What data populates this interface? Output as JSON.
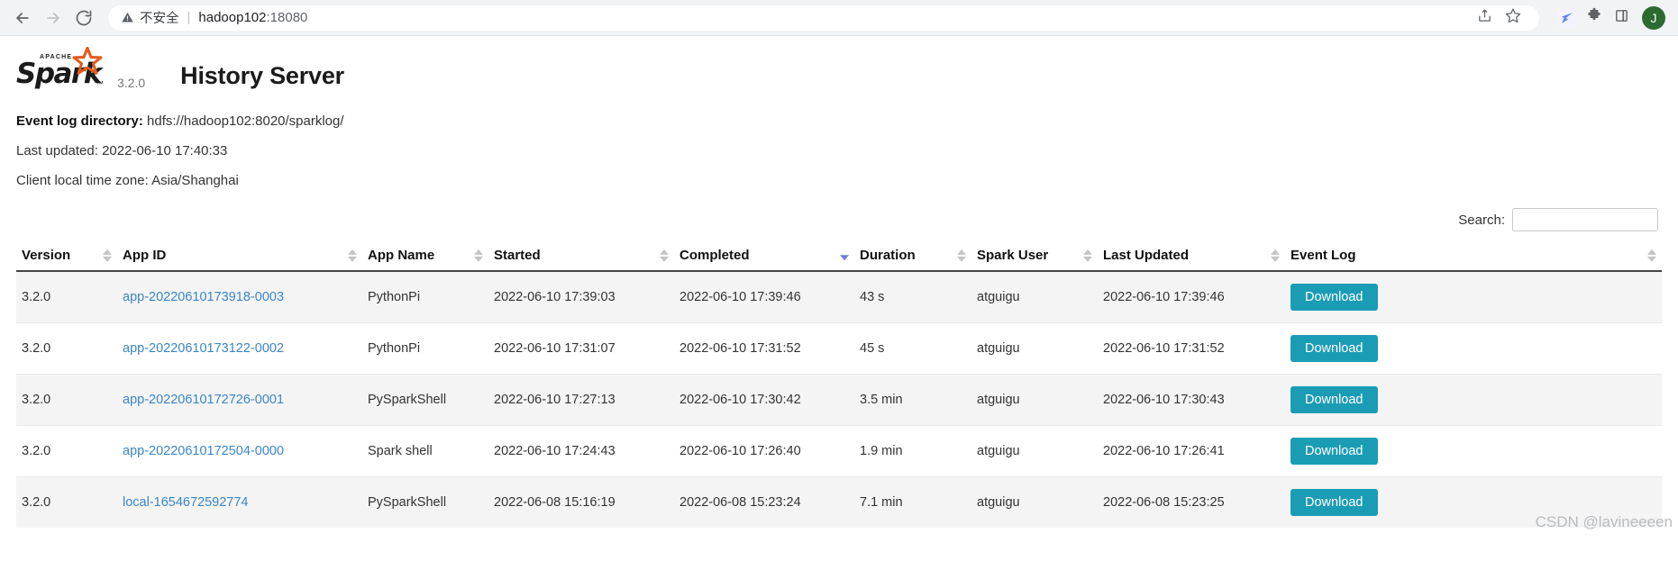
{
  "browser": {
    "back_icon": "arrow-left-icon",
    "forward_icon": "arrow-right-icon",
    "reload_icon": "reload-icon",
    "security_warning": "不安全",
    "separator": "|",
    "url_host": "hadoop102",
    "url_port": ":18080",
    "share_icon": "share-icon",
    "bookmark_icon": "star-icon",
    "extension_icon": "extension-bird-icon",
    "puzzle_icon": "puzzle-icon",
    "sidepanel_icon": "side-panel-icon",
    "profile_initial": "J"
  },
  "header": {
    "logo_word": "Spark",
    "logo_apache": "APACHE",
    "logo_tm": "™",
    "version": "3.2.0",
    "title": "History Server"
  },
  "info": {
    "event_log_label": "Event log directory:",
    "event_log_value": "hdfs://hadoop102:8020/sparklog/",
    "last_updated": "Last updated: 2022-06-10 17:40:33",
    "time_zone": "Client local time zone: Asia/Shanghai"
  },
  "search": {
    "label": "Search:",
    "value": "",
    "placeholder": ""
  },
  "table": {
    "columns": [
      {
        "label": "Version",
        "sort": "none"
      },
      {
        "label": "App ID",
        "sort": "none"
      },
      {
        "label": "App Name",
        "sort": "none"
      },
      {
        "label": "Started",
        "sort": "none"
      },
      {
        "label": "Completed",
        "sort": "desc"
      },
      {
        "label": "Duration",
        "sort": "none"
      },
      {
        "label": "Spark User",
        "sort": "none"
      },
      {
        "label": "Last Updated",
        "sort": "none"
      },
      {
        "label": "Event Log",
        "sort": "none"
      }
    ],
    "download_label": "Download",
    "rows": [
      {
        "version": "3.2.0",
        "app_id": "app-20220610173918-0003",
        "app_name": "PythonPi",
        "started": "2022-06-10 17:39:03",
        "completed": "2022-06-10 17:39:46",
        "duration": "43 s",
        "user": "atguigu",
        "last_updated": "2022-06-10 17:39:46"
      },
      {
        "version": "3.2.0",
        "app_id": "app-20220610173122-0002",
        "app_name": "PythonPi",
        "started": "2022-06-10 17:31:07",
        "completed": "2022-06-10 17:31:52",
        "duration": "45 s",
        "user": "atguigu",
        "last_updated": "2022-06-10 17:31:52"
      },
      {
        "version": "3.2.0",
        "app_id": "app-20220610172726-0001",
        "app_name": "PySparkShell",
        "started": "2022-06-10 17:27:13",
        "completed": "2022-06-10 17:30:42",
        "duration": "3.5 min",
        "user": "atguigu",
        "last_updated": "2022-06-10 17:30:43"
      },
      {
        "version": "3.2.0",
        "app_id": "app-20220610172504-0000",
        "app_name": "Spark shell",
        "started": "2022-06-10 17:24:43",
        "completed": "2022-06-10 17:26:40",
        "duration": "1.9 min",
        "user": "atguigu",
        "last_updated": "2022-06-10 17:26:41"
      },
      {
        "version": "3.2.0",
        "app_id": "local-1654672592774",
        "app_name": "PySparkShell",
        "started": "2022-06-08 15:16:19",
        "completed": "2022-06-08 15:23:24",
        "duration": "7.1 min",
        "user": "atguigu",
        "last_updated": "2022-06-08 15:23:25"
      }
    ]
  },
  "watermark": "CSDN @lavineeeen",
  "colors": {
    "link": "#3a86c8",
    "download_button": "#1b9cb5",
    "sort_active": "#6c7fd8",
    "spark_orange": "#e25a1c"
  }
}
